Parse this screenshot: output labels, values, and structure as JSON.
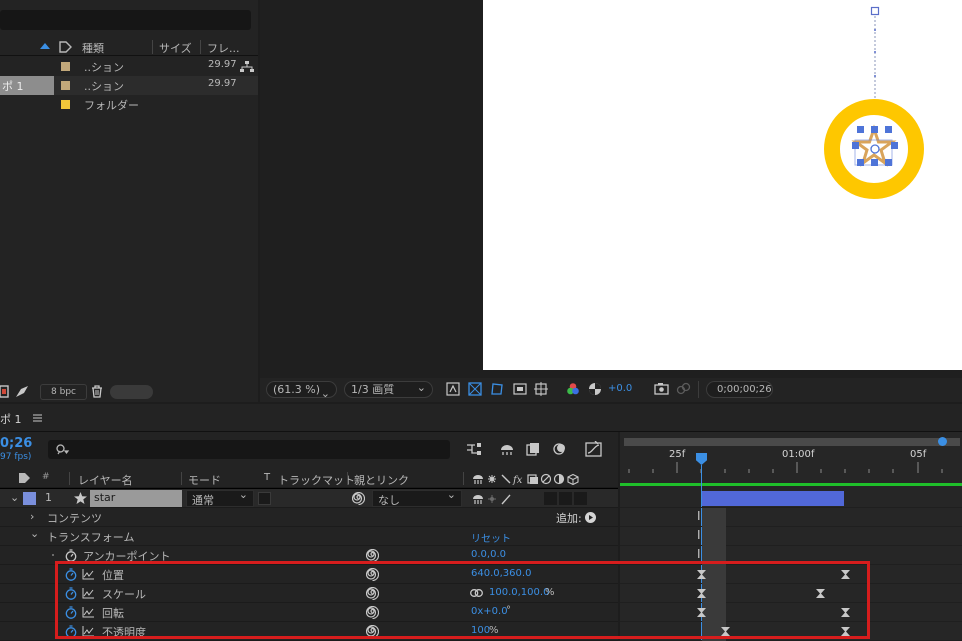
{
  "project": {
    "columns": {
      "type": "種類",
      "size": "サイズ",
      "frame": "フレ..."
    },
    "items": [
      {
        "prefix": "ポ 1",
        "name": "..ション",
        "fps": "29.97",
        "color": "#c2a87a",
        "selected": false,
        "flowchart": true
      },
      {
        "prefix": "",
        "name": "..ション",
        "fps": "29.97",
        "color": "#c2a87a",
        "selected": true,
        "flowchart": false
      },
      {
        "prefix": "",
        "name": "フォルダー",
        "fps": "",
        "color": "#f0c63a",
        "selected": false,
        "flowchart": false
      }
    ],
    "bpc": "8 bpc"
  },
  "viewer": {
    "zoom": "(61.3 %)",
    "quality": "1/3 画質",
    "exposure": "+0.0",
    "timecode": "0;00;00;26"
  },
  "timeline": {
    "comp_tab": "ポ 1",
    "menu_icon": "hamburger-icon",
    "current_time": "0;26",
    "fps": "97 fps)",
    "ruler": [
      "25f",
      "01:00f",
      "05f"
    ],
    "columns": {
      "num": "#",
      "layer_name": "レイヤー名",
      "mode": "モード",
      "t": "T",
      "track_matte": "トラックマット",
      "parent": "親とリンク"
    },
    "layer": {
      "index": "1",
      "name": "star",
      "mode": "通常",
      "parent": "なし"
    },
    "contents": "コンテンツ",
    "add_label": "追加:",
    "transform": "トランスフォーム",
    "reset": "リセット",
    "properties": [
      {
        "name": "アンカーポイント",
        "value": "0.0,0.0",
        "unit": "",
        "animated": false
      },
      {
        "name": "位置",
        "value": "640.0,360.0",
        "unit": "",
        "animated": true
      },
      {
        "name": "スケール",
        "value": "100.0,100.0",
        "unit": "%",
        "animated": true
      },
      {
        "name": "回転",
        "value": "0x+0.0",
        "unit": "°",
        "animated": true
      },
      {
        "name": "不透明度",
        "value": "100",
        "unit": "%",
        "animated": true
      }
    ]
  }
}
